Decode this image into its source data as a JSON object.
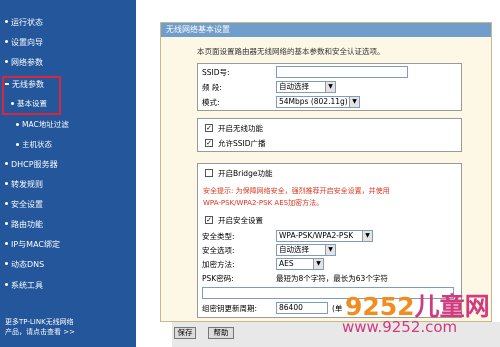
{
  "sidebar": {
    "items": [
      {
        "label": "运行状态",
        "sub": false
      },
      {
        "label": "设置向导",
        "sub": false
      },
      {
        "label": "网络参数",
        "sub": false
      },
      {
        "label": "无线参数",
        "sub": false
      },
      {
        "label": "基本设置",
        "sub": true
      },
      {
        "label": "MAC地址过滤",
        "sub": true
      },
      {
        "label": "主机状态",
        "sub": true
      },
      {
        "label": "DHCP服务器",
        "sub": false
      },
      {
        "label": "转发规则",
        "sub": false
      },
      {
        "label": "安全设置",
        "sub": false
      },
      {
        "label": "路由功能",
        "sub": false
      },
      {
        "label": "IP与MAC绑定",
        "sub": false
      },
      {
        "label": "动态DNS",
        "sub": false
      },
      {
        "label": "系统工具",
        "sub": false
      }
    ],
    "footer_line1": "更多TP-LINK无线网络",
    "footer_line2": "产品，请点击查看 >>"
  },
  "panel": {
    "title": "无线网络基本设置",
    "intro": "本页面设置路由器无线网络的基本参数和安全认证选项。"
  },
  "basic": {
    "ssid_label": "SSID号:",
    "ssid_value": "",
    "channel_label": "频 段:",
    "channel_value": "自动选择",
    "mode_label": "模式:",
    "mode_value": "54Mbps (802.11g)"
  },
  "toggles": {
    "enable_wireless": "开启无线功能",
    "enable_ssid_broadcast": "允许SSID广播"
  },
  "bridge": {
    "label": "开启Bridge功能",
    "warning_line1": "安全提示: 为保障网络安全，强烈推荐开启安全设置，并使用",
    "warning_line2": "WPA-PSK/WPA2-PSK AES加密方法。"
  },
  "security": {
    "enable_label": "开启安全设置",
    "type_label": "安全类型:",
    "type_value": "WPA-PSK/WPA2-PSK",
    "option_label": "安全选项:",
    "option_value": "自动选择",
    "encryption_label": "加密方法:",
    "encryption_value": "AES",
    "psk_label": "PSK密码:",
    "psk_hint": "最短为8个字符，最长为63个字符",
    "psk_value": "",
    "renew_label": "组密钥更新周期:",
    "renew_value": "86400",
    "renew_hint": "(单"
  },
  "buttons": {
    "save": "保存",
    "help": "帮助"
  },
  "watermark": {
    "digits": "9252",
    "suffix": "儿童网",
    "url": "www.9252.com"
  }
}
